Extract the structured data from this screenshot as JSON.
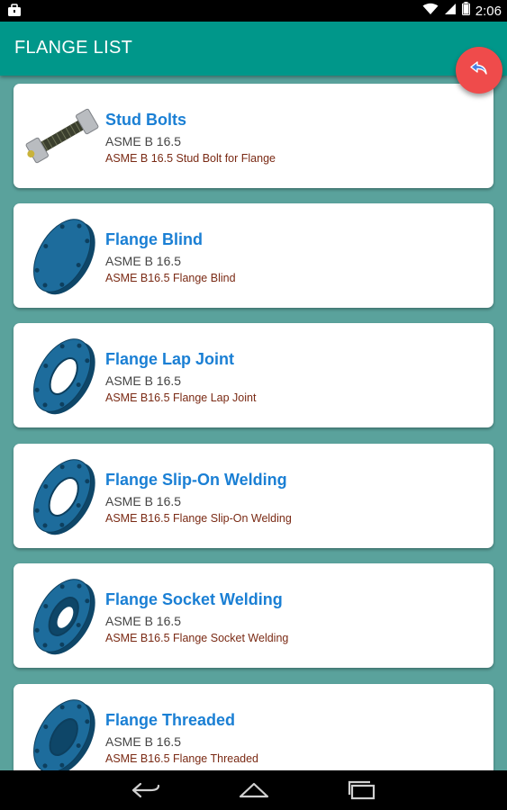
{
  "status_bar": {
    "time": "2:06",
    "icons": [
      "briefcase-icon",
      "wifi-icon",
      "signal-icon",
      "battery-icon"
    ]
  },
  "toolbar": {
    "title": "FLANGE LIST"
  },
  "fab": {
    "icon": "undo-arrow-icon",
    "color": "#ef4b4b"
  },
  "colors": {
    "toolbar": "#00978a",
    "background": "#5aa29c",
    "item_title": "#1a7fd4",
    "item_desc": "#7a2a14",
    "flange_blue": "#1d6c9c"
  },
  "items": [
    {
      "title": "Stud Bolts",
      "standard": "ASME B 16.5",
      "description": "ASME B 16.5 Stud Bolt for Flange",
      "icon": "stud-bolt-icon"
    },
    {
      "title": "Flange Blind",
      "standard": "ASME B 16.5",
      "description": "ASME B16.5 Flange Blind",
      "icon": "flange-blind-icon"
    },
    {
      "title": "Flange Lap Joint",
      "standard": "ASME B 16.5",
      "description": "ASME B16.5 Flange Lap Joint",
      "icon": "flange-lap-joint-icon"
    },
    {
      "title": "Flange Slip-On Welding",
      "standard": "ASME B 16.5",
      "description": "ASME B16.5 Flange Slip-On Welding",
      "icon": "flange-slip-on-icon"
    },
    {
      "title": "Flange Socket Welding",
      "standard": "ASME B 16.5",
      "description": "ASME B16.5 Flange Socket Welding",
      "icon": "flange-socket-icon"
    },
    {
      "title": "Flange Threaded",
      "standard": "ASME B 16.5",
      "description": "ASME B16.5 Flange Threaded",
      "icon": "flange-threaded-icon"
    }
  ],
  "nav_bar": {
    "buttons": [
      "back-icon",
      "home-icon",
      "recents-icon"
    ]
  }
}
